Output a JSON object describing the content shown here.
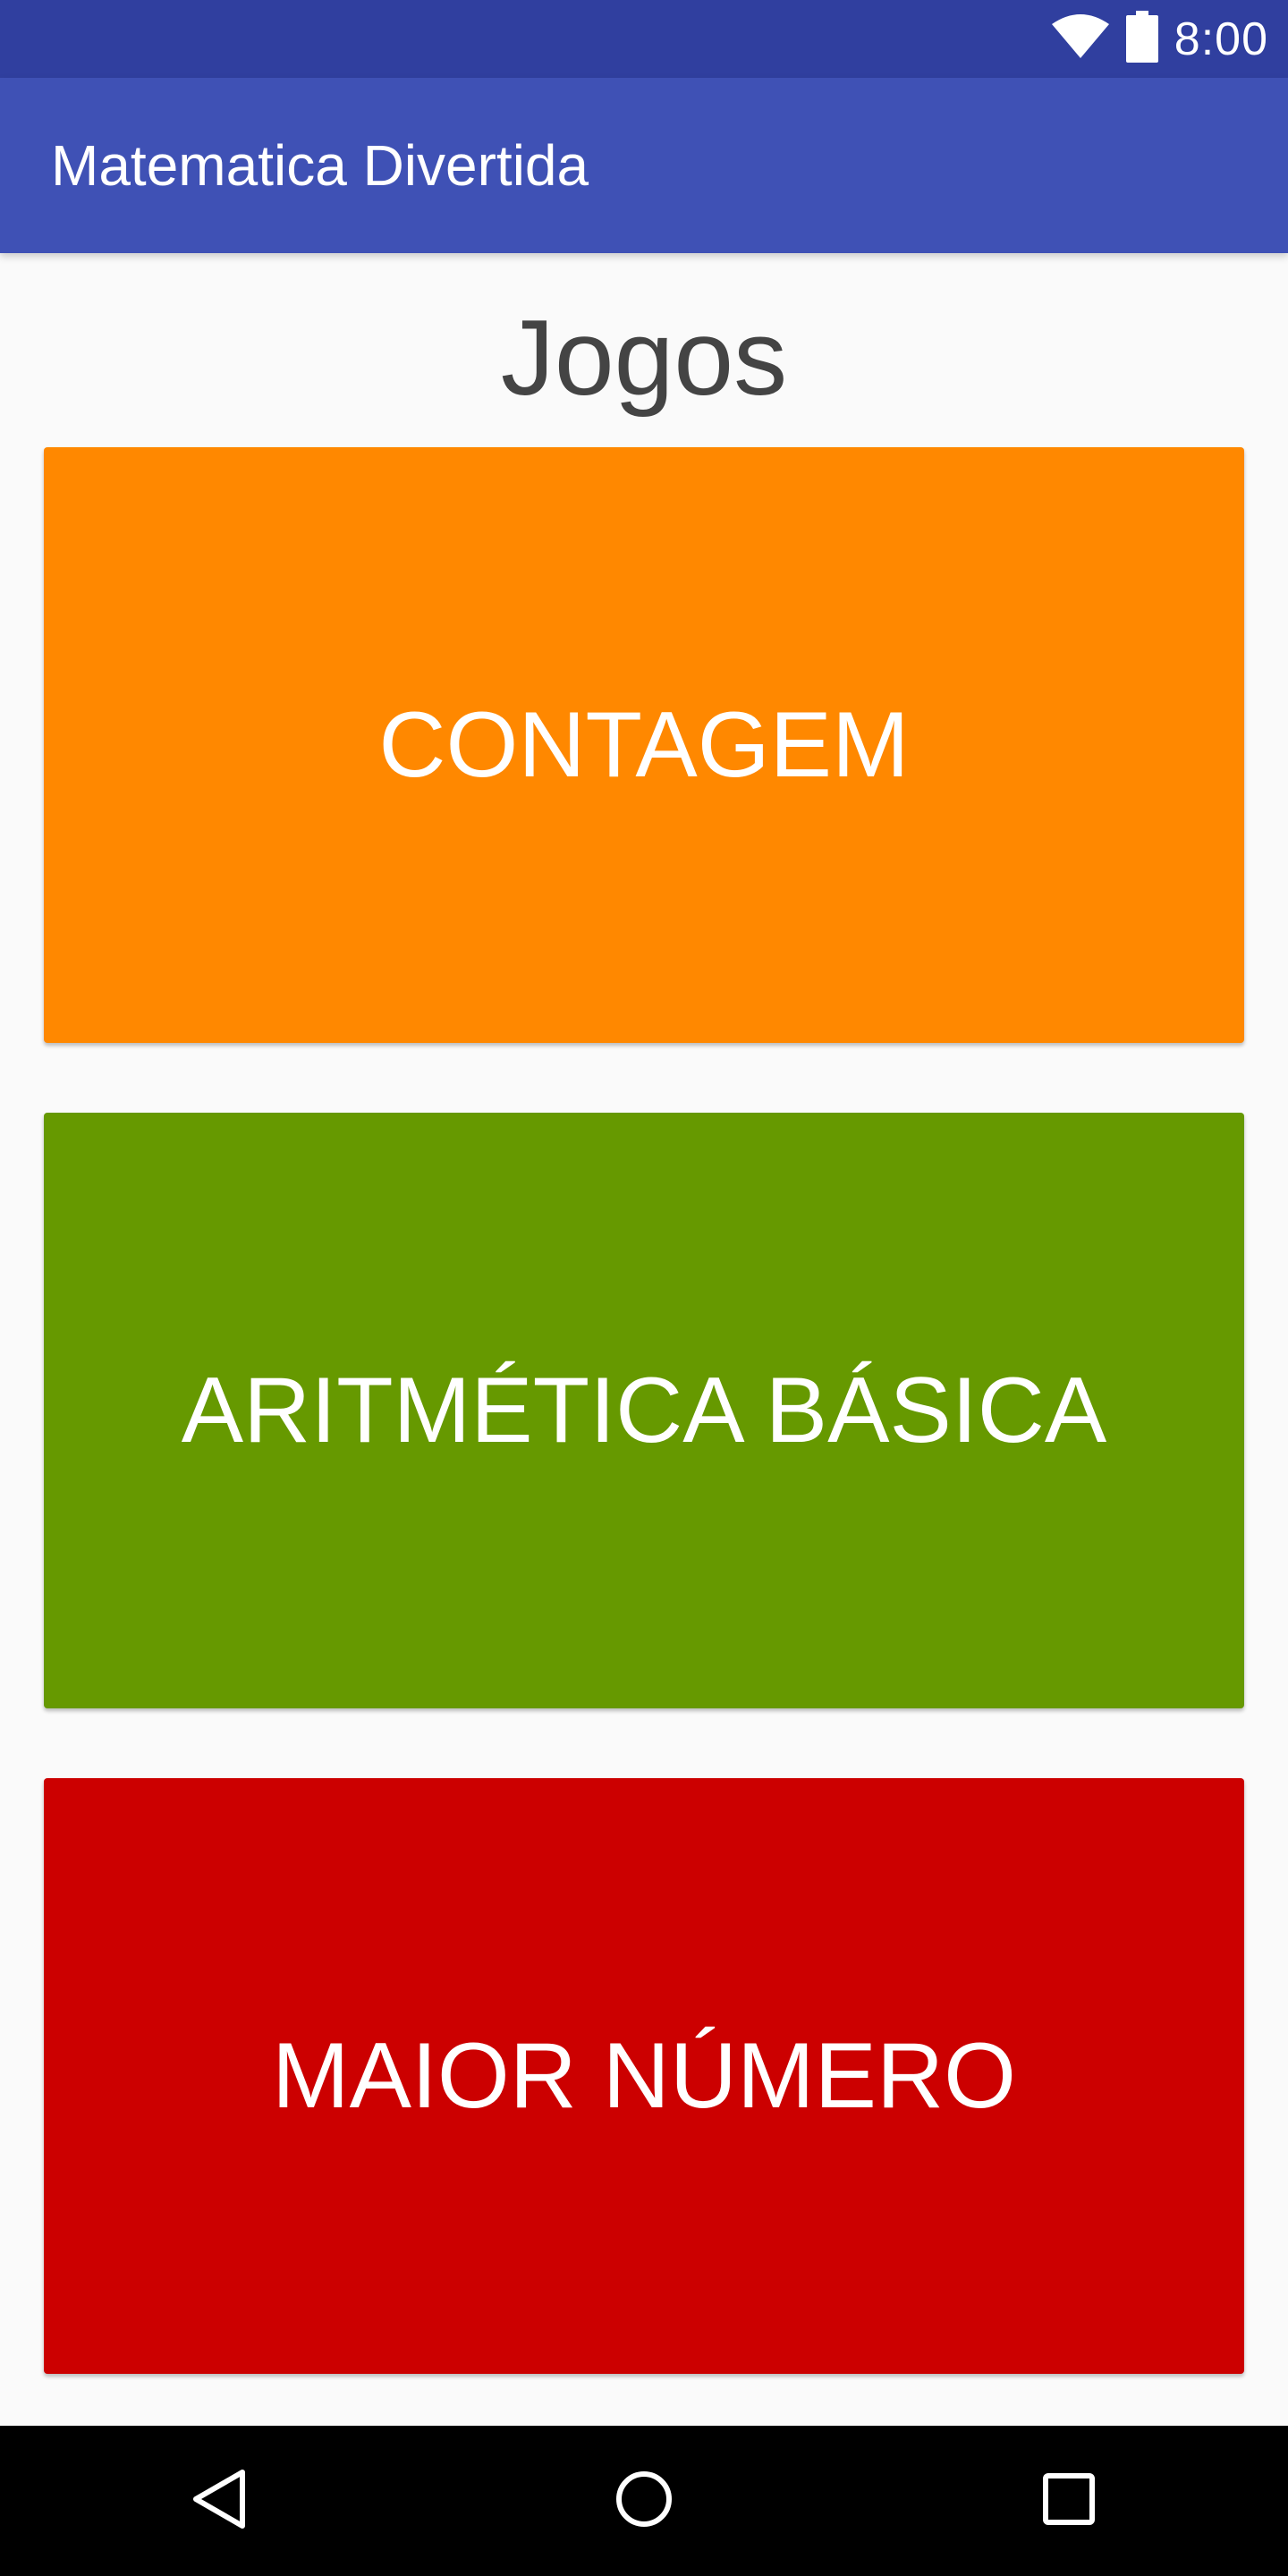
{
  "status_bar": {
    "time": "8:00",
    "icons": [
      "wifi-icon",
      "battery-icon"
    ],
    "background": "#303f9f"
  },
  "app_bar": {
    "title": "Matematica Divertida",
    "background": "#3f51b5"
  },
  "main": {
    "heading": "Jogos",
    "games": [
      {
        "label": "CONTAGEM",
        "color": "#ff8800"
      },
      {
        "label": "ARITMÉTICA BÁSICA",
        "color": "#669900"
      },
      {
        "label": "MAIOR NÚMERO",
        "color": "#cc0000"
      }
    ]
  },
  "nav_bar": {
    "icons": [
      "back-icon",
      "home-icon",
      "recent-apps-icon"
    ]
  }
}
